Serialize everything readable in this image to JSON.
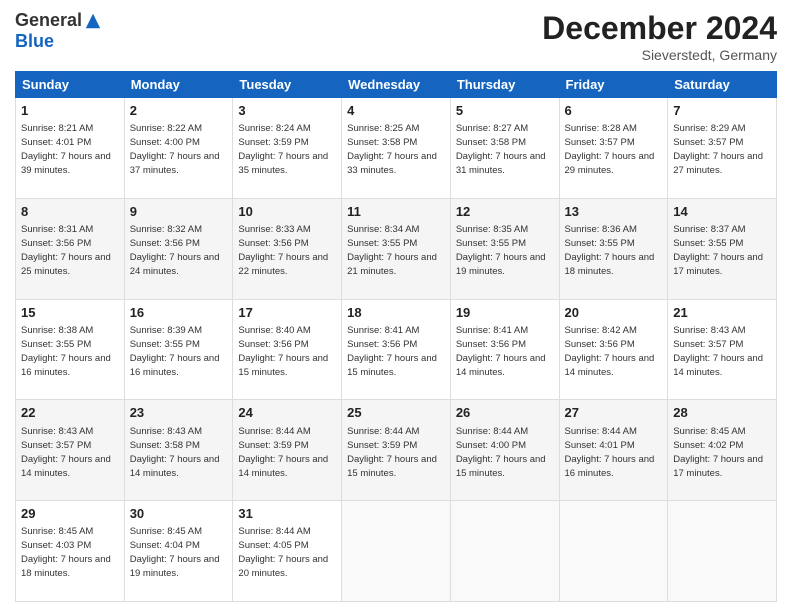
{
  "header": {
    "logo_general": "General",
    "logo_blue": "Blue",
    "month_title": "December 2024",
    "location": "Sieverstedt, Germany"
  },
  "days_of_week": [
    "Sunday",
    "Monday",
    "Tuesday",
    "Wednesday",
    "Thursday",
    "Friday",
    "Saturday"
  ],
  "weeks": [
    [
      {
        "day": "1",
        "sunrise": "8:21 AM",
        "sunset": "4:01 PM",
        "daylight": "7 hours and 39 minutes."
      },
      {
        "day": "2",
        "sunrise": "8:22 AM",
        "sunset": "4:00 PM",
        "daylight": "7 hours and 37 minutes."
      },
      {
        "day": "3",
        "sunrise": "8:24 AM",
        "sunset": "3:59 PM",
        "daylight": "7 hours and 35 minutes."
      },
      {
        "day": "4",
        "sunrise": "8:25 AM",
        "sunset": "3:58 PM",
        "daylight": "7 hours and 33 minutes."
      },
      {
        "day": "5",
        "sunrise": "8:27 AM",
        "sunset": "3:58 PM",
        "daylight": "7 hours and 31 minutes."
      },
      {
        "day": "6",
        "sunrise": "8:28 AM",
        "sunset": "3:57 PM",
        "daylight": "7 hours and 29 minutes."
      },
      {
        "day": "7",
        "sunrise": "8:29 AM",
        "sunset": "3:57 PM",
        "daylight": "7 hours and 27 minutes."
      }
    ],
    [
      {
        "day": "8",
        "sunrise": "8:31 AM",
        "sunset": "3:56 PM",
        "daylight": "7 hours and 25 minutes."
      },
      {
        "day": "9",
        "sunrise": "8:32 AM",
        "sunset": "3:56 PM",
        "daylight": "7 hours and 24 minutes."
      },
      {
        "day": "10",
        "sunrise": "8:33 AM",
        "sunset": "3:56 PM",
        "daylight": "7 hours and 22 minutes."
      },
      {
        "day": "11",
        "sunrise": "8:34 AM",
        "sunset": "3:55 PM",
        "daylight": "7 hours and 21 minutes."
      },
      {
        "day": "12",
        "sunrise": "8:35 AM",
        "sunset": "3:55 PM",
        "daylight": "7 hours and 19 minutes."
      },
      {
        "day": "13",
        "sunrise": "8:36 AM",
        "sunset": "3:55 PM",
        "daylight": "7 hours and 18 minutes."
      },
      {
        "day": "14",
        "sunrise": "8:37 AM",
        "sunset": "3:55 PM",
        "daylight": "7 hours and 17 minutes."
      }
    ],
    [
      {
        "day": "15",
        "sunrise": "8:38 AM",
        "sunset": "3:55 PM",
        "daylight": "7 hours and 16 minutes."
      },
      {
        "day": "16",
        "sunrise": "8:39 AM",
        "sunset": "3:55 PM",
        "daylight": "7 hours and 16 minutes."
      },
      {
        "day": "17",
        "sunrise": "8:40 AM",
        "sunset": "3:56 PM",
        "daylight": "7 hours and 15 minutes."
      },
      {
        "day": "18",
        "sunrise": "8:41 AM",
        "sunset": "3:56 PM",
        "daylight": "7 hours and 15 minutes."
      },
      {
        "day": "19",
        "sunrise": "8:41 AM",
        "sunset": "3:56 PM",
        "daylight": "7 hours and 14 minutes."
      },
      {
        "day": "20",
        "sunrise": "8:42 AM",
        "sunset": "3:56 PM",
        "daylight": "7 hours and 14 minutes."
      },
      {
        "day": "21",
        "sunrise": "8:43 AM",
        "sunset": "3:57 PM",
        "daylight": "7 hours and 14 minutes."
      }
    ],
    [
      {
        "day": "22",
        "sunrise": "8:43 AM",
        "sunset": "3:57 PM",
        "daylight": "7 hours and 14 minutes."
      },
      {
        "day": "23",
        "sunrise": "8:43 AM",
        "sunset": "3:58 PM",
        "daylight": "7 hours and 14 minutes."
      },
      {
        "day": "24",
        "sunrise": "8:44 AM",
        "sunset": "3:59 PM",
        "daylight": "7 hours and 14 minutes."
      },
      {
        "day": "25",
        "sunrise": "8:44 AM",
        "sunset": "3:59 PM",
        "daylight": "7 hours and 15 minutes."
      },
      {
        "day": "26",
        "sunrise": "8:44 AM",
        "sunset": "4:00 PM",
        "daylight": "7 hours and 15 minutes."
      },
      {
        "day": "27",
        "sunrise": "8:44 AM",
        "sunset": "4:01 PM",
        "daylight": "7 hours and 16 minutes."
      },
      {
        "day": "28",
        "sunrise": "8:45 AM",
        "sunset": "4:02 PM",
        "daylight": "7 hours and 17 minutes."
      }
    ],
    [
      {
        "day": "29",
        "sunrise": "8:45 AM",
        "sunset": "4:03 PM",
        "daylight": "7 hours and 18 minutes."
      },
      {
        "day": "30",
        "sunrise": "8:45 AM",
        "sunset": "4:04 PM",
        "daylight": "7 hours and 19 minutes."
      },
      {
        "day": "31",
        "sunrise": "8:44 AM",
        "sunset": "4:05 PM",
        "daylight": "7 hours and 20 minutes."
      },
      null,
      null,
      null,
      null
    ]
  ]
}
